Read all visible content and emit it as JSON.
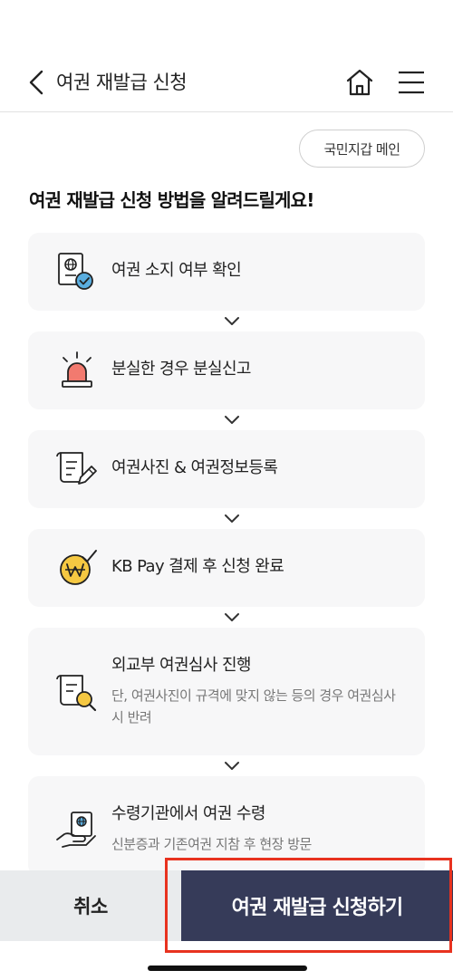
{
  "header": {
    "title": "여권 재발급 신청",
    "back_icon": "chevron-left-icon",
    "home_icon": "home-icon",
    "menu_icon": "hamburger-menu-icon"
  },
  "wallet_button": {
    "label": "국민지갑 메인"
  },
  "section": {
    "title": "여권 재발급 신청 방법을 알려드릴게요!"
  },
  "steps": [
    {
      "icon": "passport-check-icon",
      "label": "여권 소지 여부 확인"
    },
    {
      "icon": "alarm-siren-icon",
      "label": "분실한 경우 분실신고"
    },
    {
      "icon": "document-pen-icon",
      "label": "여권사진 & 여권정보등록"
    },
    {
      "icon": "won-pay-check-icon",
      "label": "KB Pay 결제 후 신청 완료"
    },
    {
      "icon": "document-search-icon",
      "label": "외교부 여권심사 진행",
      "desc": "단, 여권사진이 규격에 맞지 않는 등의 경우 여권심사 시 반려"
    },
    {
      "icon": "hand-passport-icon",
      "label": "수령기관에서 여권 수령",
      "desc": "신분증과 기존여권 지참 후 현장 방문"
    }
  ],
  "bottom": {
    "cancel_label": "취소",
    "apply_label": "여권 재발급 신청하기"
  },
  "colors": {
    "primary_button": "#363b59",
    "cancel_button": "#e9ebed",
    "highlight_border": "#e8321f",
    "card_background": "#f7f7f8",
    "icon_accent_blue": "#5aaee0",
    "icon_accent_red": "#f27a6f",
    "icon_accent_yellow": "#f5c842"
  }
}
